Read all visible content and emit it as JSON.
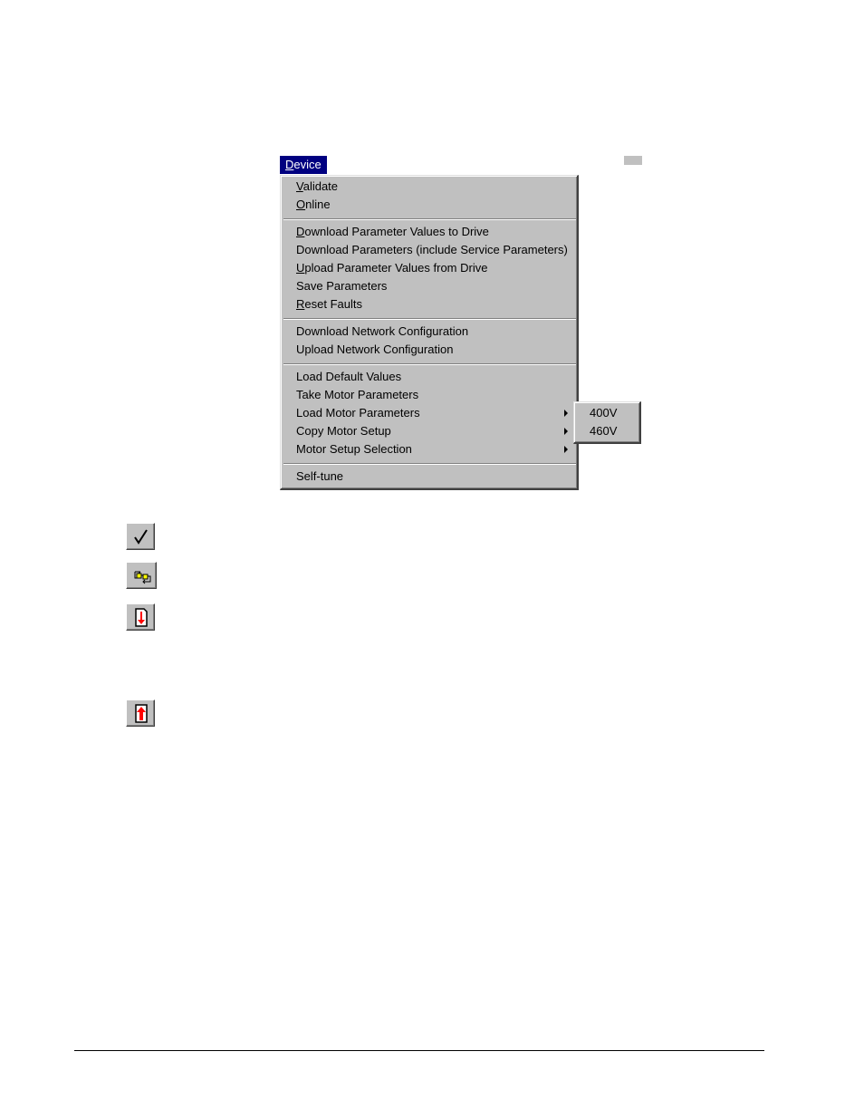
{
  "menu": {
    "title": "Device",
    "title_mnemonic": "D",
    "title_rest": "evice",
    "groups": [
      [
        {
          "mnemonic": "V",
          "rest": "alidate",
          "label": "Validate",
          "submenu": false
        },
        {
          "mnemonic": "O",
          "rest": "nline",
          "label": "Online",
          "submenu": false
        }
      ],
      [
        {
          "mnemonic": "D",
          "rest": "ownload Parameter Values to Drive",
          "label": "Download Parameter Values to Drive",
          "submenu": false
        },
        {
          "mnemonic": "",
          "rest": "Download Parameters (include Service Parameters)",
          "label": "Download Parameters (include Service Parameters)",
          "submenu": false
        },
        {
          "mnemonic": "U",
          "rest": "pload Parameter Values from Drive",
          "label": "Upload Parameter Values from Drive",
          "submenu": false
        },
        {
          "mnemonic": "",
          "rest": "Save Parameters",
          "label": "Save Parameters",
          "submenu": false
        },
        {
          "mnemonic": "R",
          "rest": "eset Faults",
          "label": "Reset Faults",
          "submenu": false
        }
      ],
      [
        {
          "mnemonic": "",
          "rest": "Download Network Configuration",
          "label": "Download Network Configuration",
          "submenu": false
        },
        {
          "mnemonic": "",
          "rest": "Upload Network Configuration",
          "label": "Upload Network Configuration",
          "submenu": false
        }
      ],
      [
        {
          "mnemonic": "",
          "rest": "Load Default Values",
          "label": "Load Default Values",
          "submenu": false
        },
        {
          "mnemonic": "",
          "rest": "Take Motor Parameters",
          "label": "Take Motor Parameters",
          "submenu": false
        },
        {
          "mnemonic": "",
          "rest": "Load Motor Parameters",
          "label": "Load Motor Parameters",
          "submenu": true
        },
        {
          "mnemonic": "",
          "rest": "Copy Motor Setup",
          "label": "Copy Motor Setup",
          "submenu": true
        },
        {
          "mnemonic": "",
          "rest": "Motor Setup Selection",
          "label": "Motor Setup Selection",
          "submenu": true
        }
      ],
      [
        {
          "mnemonic": "",
          "rest": "Self-tune",
          "label": "Self-tune",
          "submenu": false
        }
      ]
    ],
    "submenu_items": [
      "400V",
      "460V"
    ]
  },
  "toolbar_icons": [
    {
      "name": "validate-checkmark-icon",
      "tooltip": ""
    },
    {
      "name": "online-connection-icon",
      "tooltip": ""
    },
    {
      "name": "download-to-drive-icon",
      "tooltip": ""
    },
    {
      "name": "upload-from-drive-icon",
      "tooltip": ""
    }
  ],
  "colors": {
    "menu_highlight": "#000080",
    "menu_face": "#c0c0c0",
    "icon_red": "#ff0000",
    "icon_yellow": "#ffff00"
  }
}
